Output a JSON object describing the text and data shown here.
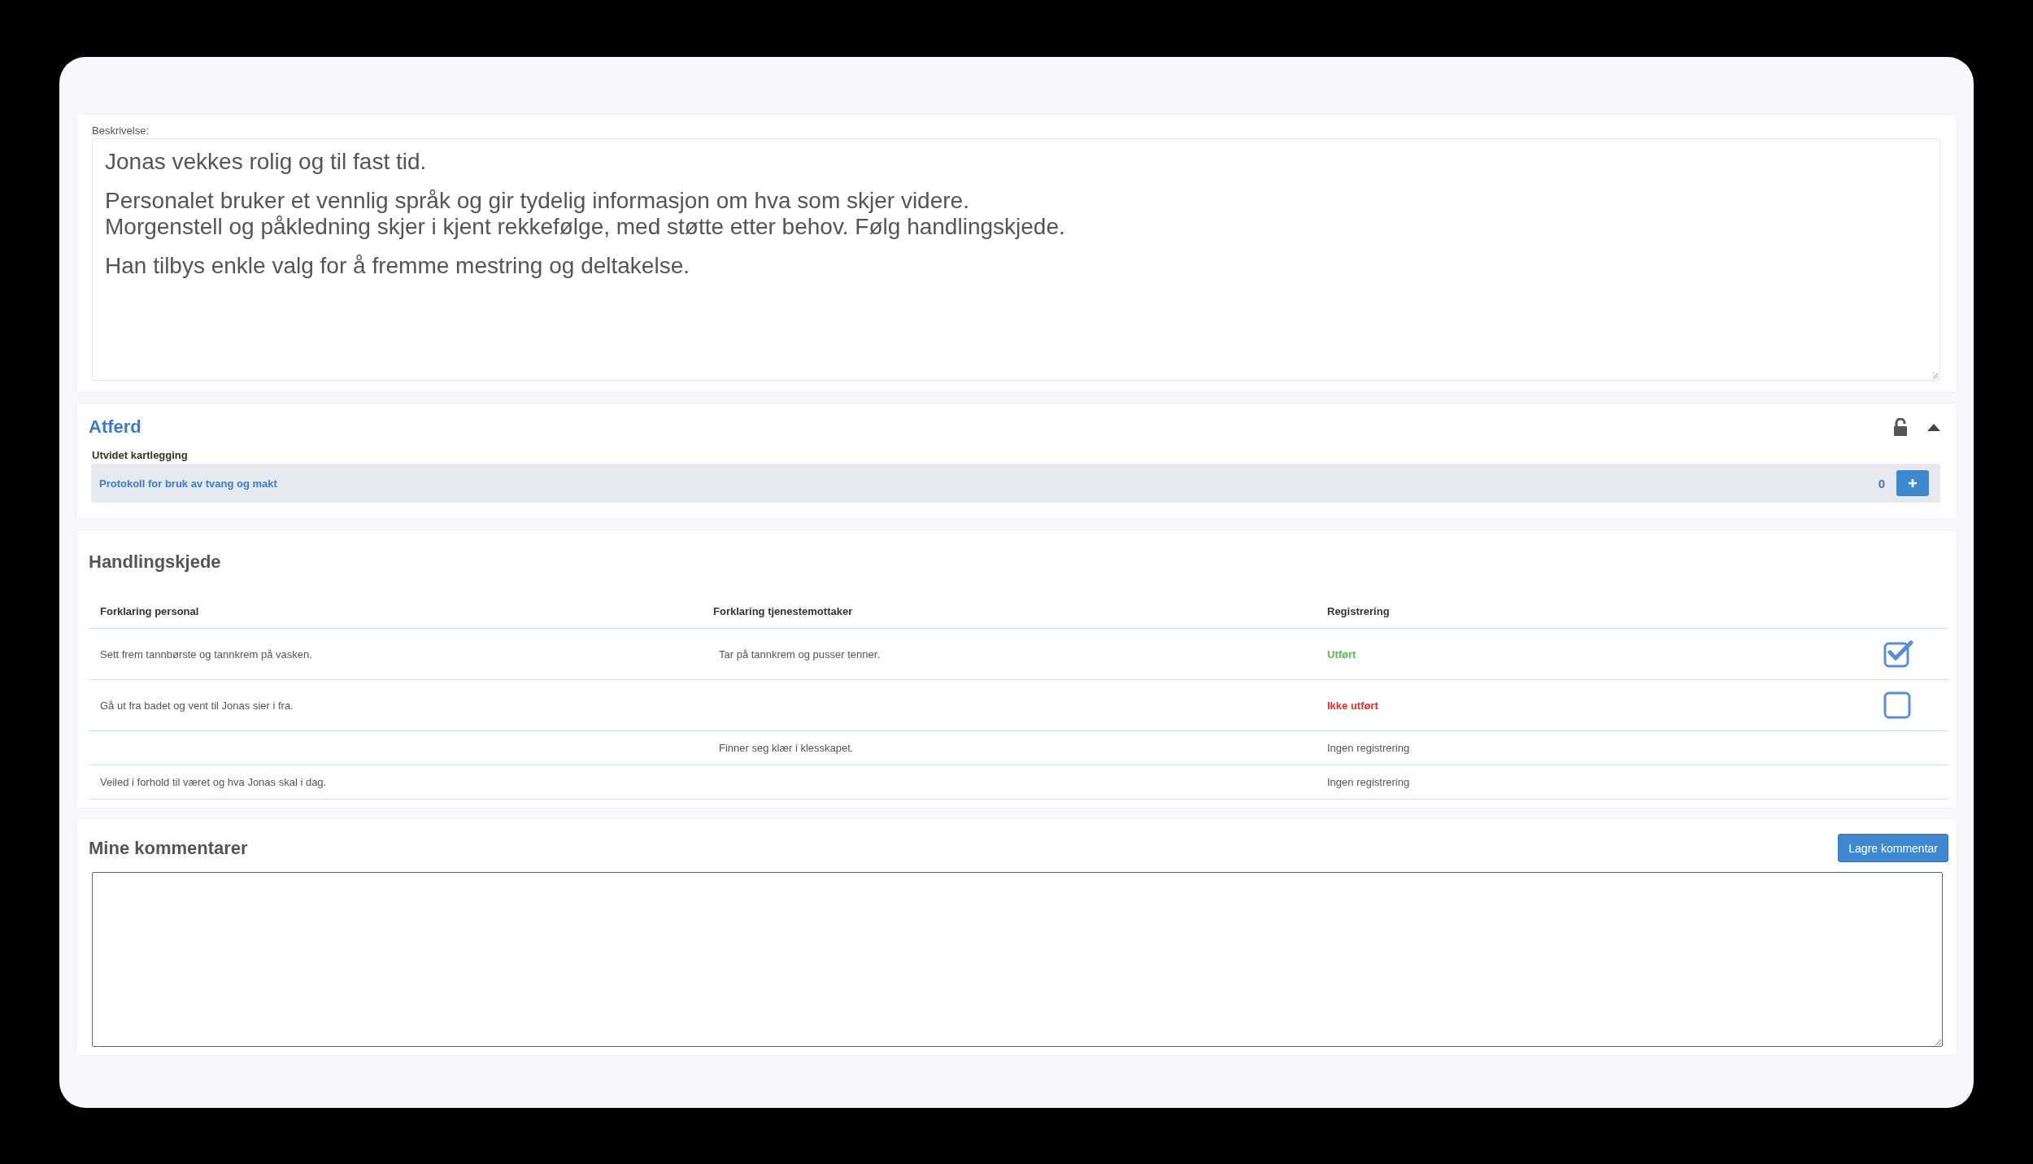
{
  "description": {
    "label": "Beskrivelse:",
    "paragraphs": [
      [
        "Jonas vekkes rolig og til fast tid."
      ],
      [
        "Personalet bruker et vennlig språk og gir tydelig informasjon om hva som skjer videre.",
        "Morgenstell og påkledning skjer i kjent rekkefølge, med støtte etter behov. Følg handlingskjede."
      ],
      [
        "Han tilbys enkle valg for å fremme mestring og deltakelse."
      ]
    ]
  },
  "atferd": {
    "title": "Atferd",
    "locked": false,
    "expanded": true,
    "subtitle": "Utvidet kartlegging",
    "items": [
      {
        "label": "Protokoll for bruk av tvang og makt",
        "count": "0"
      }
    ]
  },
  "chain": {
    "title": "Handlingskjede",
    "columns": [
      "Forklaring personal",
      "Forklaring tjenestemottaker",
      "Registrering"
    ],
    "rows": [
      {
        "kind": "done",
        "personal": "Sett frem tannbørste og tannkrem på vasken.",
        "recipient": "Tar på tannkrem og pusser tenner.",
        "registration": "Utført",
        "checked": true
      },
      {
        "kind": "not_done",
        "personal": "Gå ut fra badet og vent til Jonas sier i fra.",
        "registration": "Ikke utført",
        "checked": false
      },
      {
        "kind": "unregistered",
        "recipient": "Finner seg klær i klesskapet.",
        "registration": "Ingen registrering"
      },
      {
        "kind": "unregistered",
        "personal": "Veiled i forhold til været og hva Jonas skal i dag.",
        "registration": "Ingen registrering"
      }
    ]
  },
  "comments": {
    "title": "Mine kommentarer",
    "save_button": "Lagre kommentar"
  }
}
